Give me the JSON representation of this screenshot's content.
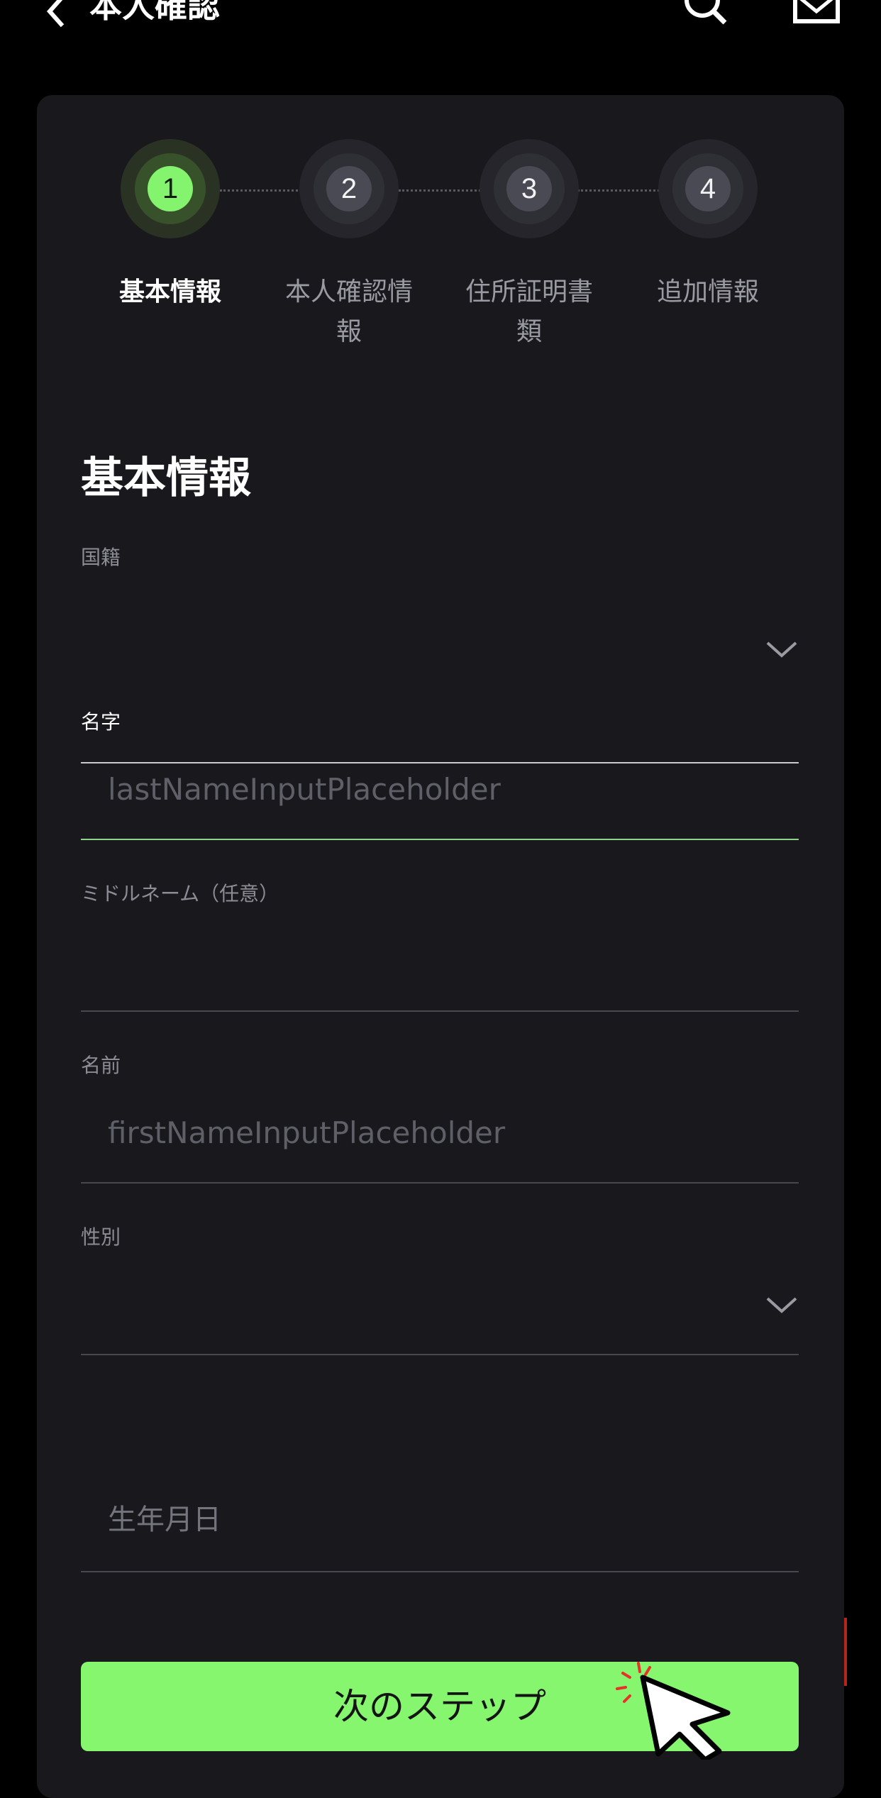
{
  "header": {
    "title": "本人確認"
  },
  "stepper": {
    "steps": [
      {
        "number": "1",
        "label": "基本情報",
        "active": true
      },
      {
        "number": "2",
        "label": "本人確認情報",
        "active": false
      },
      {
        "number": "3",
        "label": "住所証明書類",
        "active": false
      },
      {
        "number": "4",
        "label": "追加情報",
        "active": false
      }
    ]
  },
  "form": {
    "section_title": "基本情報",
    "nationality": {
      "label": "国籍",
      "value": ""
    },
    "last_name": {
      "label": "名字",
      "placeholder": "lastNameInputPlaceholder",
      "value": ""
    },
    "middle_name": {
      "label": "ミドルネーム（任意）",
      "value": ""
    },
    "first_name": {
      "label": "名前",
      "placeholder": "firstNameInputPlaceholder",
      "value": ""
    },
    "gender": {
      "label": "性別",
      "value": ""
    },
    "birth_date": {
      "placeholder": "生年月日"
    }
  },
  "actions": {
    "next_label": "次のステップ"
  },
  "colors": {
    "accent": "#86f66e",
    "card_background": "#18181d",
    "page_background": "#000000"
  },
  "icons": [
    "back-icon",
    "search-icon",
    "mail-icon",
    "chevron-down-icon",
    "cursor-icon"
  ]
}
